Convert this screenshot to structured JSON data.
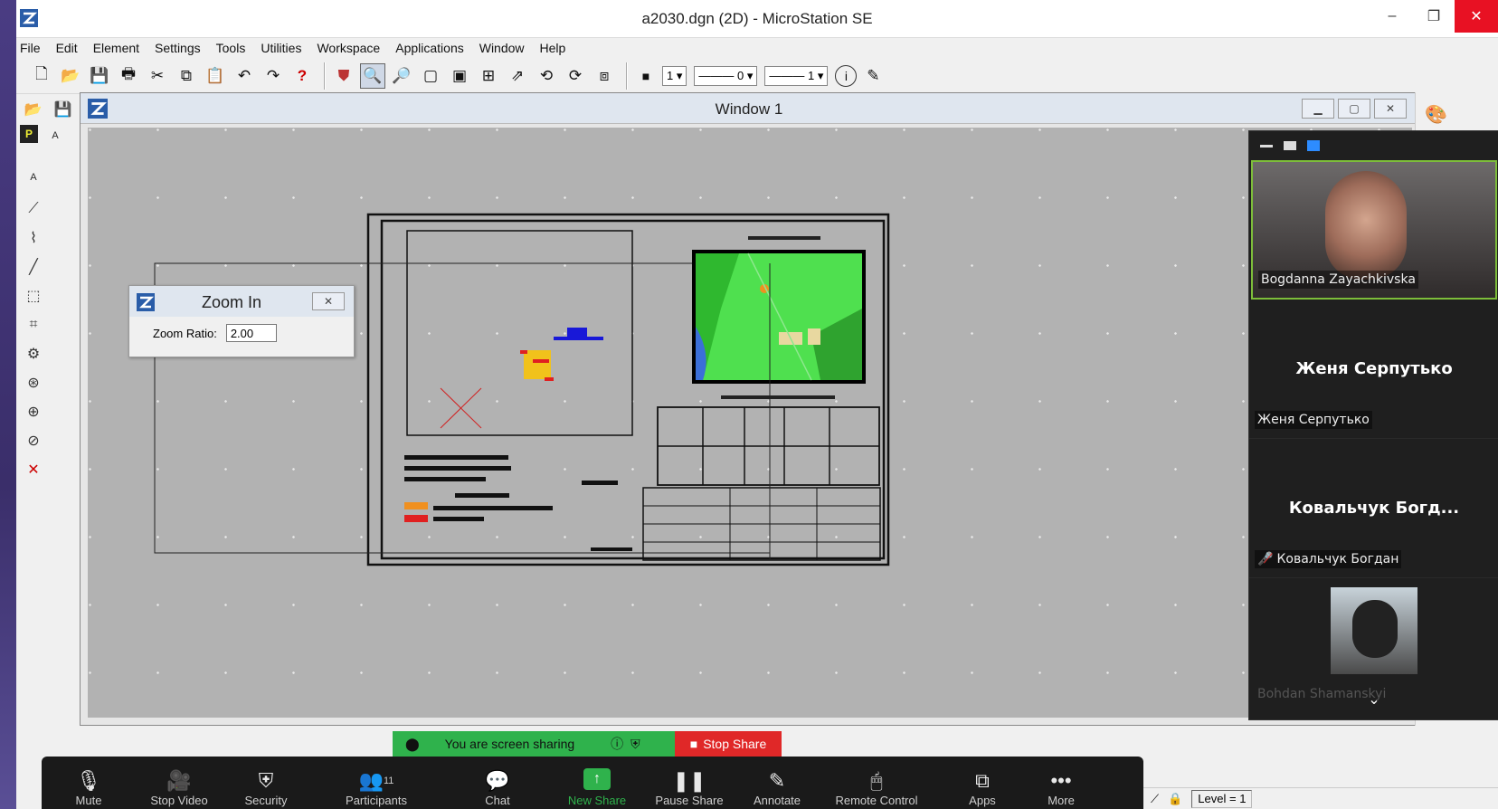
{
  "window": {
    "title": "a2030.dgn (2D) - MicroStation SE"
  },
  "menu": [
    "File",
    "Edit",
    "Element",
    "Settings",
    "Tools",
    "Utilities",
    "Workspace",
    "Applications",
    "Window",
    "Help"
  ],
  "toolbar": {
    "color_value": "1",
    "weight_value": "0",
    "style_value": "1"
  },
  "view_window": {
    "title": "Window 1"
  },
  "zoom_dialog": {
    "title": "Zoom In",
    "ratio_label": "Zoom Ratio:",
    "ratio_value": "2.00"
  },
  "participants": [
    {
      "name": "Bogdanna Zayachkivska",
      "has_video": true
    },
    {
      "display_name": "Женя Серпутько",
      "label": "Женя Серпутько",
      "has_video": false
    },
    {
      "display_name": "Ковальчук Богд...",
      "label": "Ковальчук Богдан",
      "has_video": false,
      "muted": true
    },
    {
      "name": "Bohdan Shamanskyi",
      "has_video": true
    }
  ],
  "share_banner": {
    "message": "You are screen sharing",
    "stop_label": "Stop Share"
  },
  "zoom_toolbar": {
    "mute": "Mute",
    "stop_video": "Stop Video",
    "security": "Security",
    "participants": "Participants",
    "participants_count": "11",
    "chat": "Chat",
    "new_share": "New Share",
    "pause_share": "Pause Share",
    "annotate": "Annotate",
    "remote_control": "Remote Control",
    "apps": "Apps",
    "more": "More"
  },
  "status": {
    "level": "Level = 1"
  },
  "colors": {
    "share_green": "#2fb24c",
    "stop_red": "#e02828",
    "zoom_bg": "#1a1a1a",
    "canvas_gray": "#b2b2b2"
  }
}
